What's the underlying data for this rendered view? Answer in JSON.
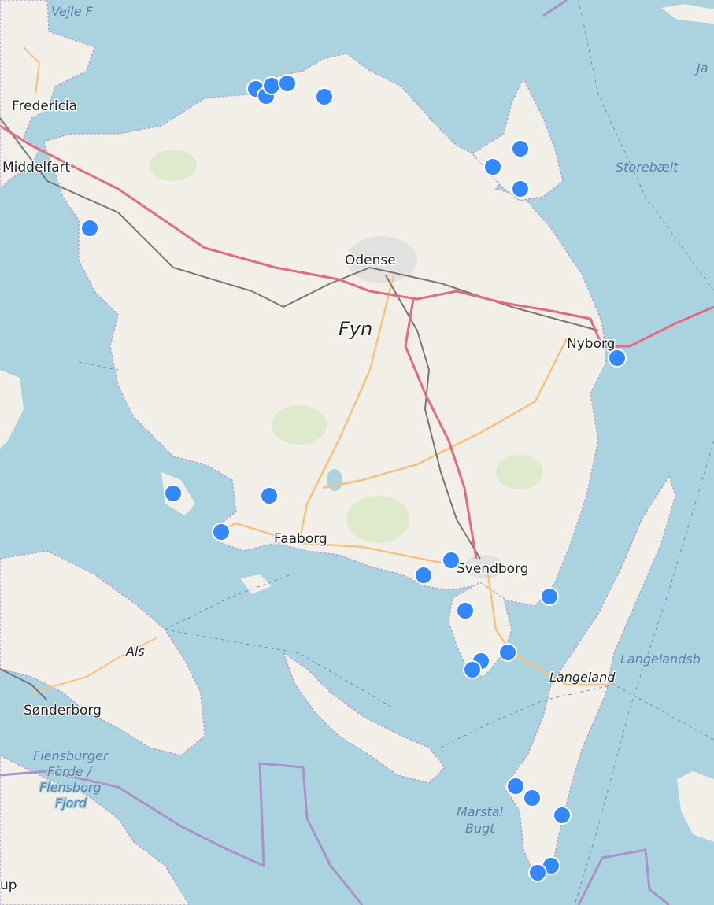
{
  "map": {
    "labels": {
      "fyn": "Fyn",
      "odense": "Odense",
      "nyborg": "Nyborg",
      "svendborg": "Svendborg",
      "faaborg": "Faaborg",
      "middelfart": "Middelfart",
      "fredericia": "Fredericia",
      "langeland": "Langeland",
      "als": "Als",
      "sonderborg": "Sønderborg",
      "up": "up"
    },
    "water_labels": {
      "vejle": "Vejle F",
      "storebaelt": "Storebælt",
      "langelandsb": "Langelandsb",
      "flensburger1": "Flensburger",
      "flensburger2": "Förde /",
      "flensburger3": "Flensborg",
      "flensburger4": "Fjord",
      "marstal1": "Marstal",
      "marstal2": "Bugt",
      "ja": "Ja"
    },
    "colors": {
      "water": "#aad3df",
      "land": "#f2efe9",
      "green": "#e5eed7",
      "motorway": "#e36b80",
      "primary": "#f7c27d",
      "railway": "#777777",
      "border": "#a991c9",
      "marker": "#3388ff"
    },
    "markers": [
      "marker-1",
      "marker-2",
      "marker-3",
      "marker-4",
      "marker-5",
      "marker-6",
      "marker-7",
      "marker-8",
      "marker-9",
      "marker-10",
      "marker-11",
      "marker-12",
      "marker-13",
      "marker-14",
      "marker-15",
      "marker-16",
      "marker-17",
      "marker-18",
      "marker-19",
      "marker-20",
      "marker-21",
      "marker-22",
      "marker-23",
      "marker-24",
      "marker-25",
      "marker-26",
      "marker-27",
      "marker-28"
    ]
  }
}
